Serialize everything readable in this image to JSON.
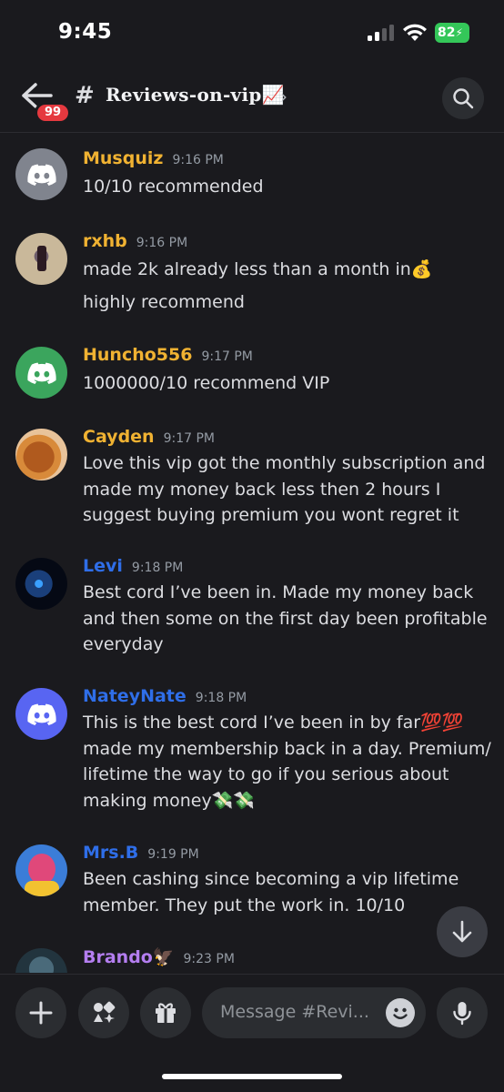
{
  "status_bar": {
    "time": "9:45",
    "battery": "82"
  },
  "header": {
    "back_badge": "99",
    "hash": "#",
    "channel_name": "Reviews-on-vip📈",
    "chevron": "›"
  },
  "messages": [
    {
      "username": "Musquiz",
      "time": "9:16 PM",
      "color": "#f0b232",
      "avatar": "discord-grey",
      "lines": [
        "10/10 recommended"
      ]
    },
    {
      "username": "rxhb",
      "time": "9:16 PM",
      "color": "#f0b232",
      "avatar": "photo",
      "lines": [
        "made 2k already less than a month in💰",
        "highly recommend"
      ]
    },
    {
      "username": "Huncho556",
      "time": "9:17 PM",
      "color": "#f0b232",
      "avatar": "discord-green",
      "lines": [
        "1000000/10 recommend VIP"
      ]
    },
    {
      "username": "Cayden",
      "time": "9:17 PM",
      "color": "#f0b232",
      "avatar": "photo",
      "lines": [
        "Love this vip got the monthly subscription and made my money back less then 2 hours I suggest buying premium you wont regret it"
      ]
    },
    {
      "username": "Levi",
      "time": "9:18 PM",
      "color": "#2f6ee8",
      "avatar": "photo",
      "lines": [
        "Best cord I’ve been in. Made my money back and then some on the first day been profitable everyday"
      ]
    },
    {
      "username": "NateyNate",
      "time": "9:18 PM",
      "color": "#2f6ee8",
      "avatar": "discord-blue",
      "lines": [
        "This is the best cord I’ve been in by far💯💯 made my membership back in a day. Premium/ lifetime the way to go if you serious about making money💸💸"
      ]
    },
    {
      "username": "Mrs.B",
      "time": "9:19 PM",
      "color": "#2f6ee8",
      "avatar": "photo",
      "lines": [
        "Been cashing since becoming a vip lifetime member. They put the work in. 10/10"
      ]
    },
    {
      "username": "Brando🦅",
      "time": "9:23 PM",
      "color": "#b47ef0",
      "avatar": "photo",
      "lines": []
    }
  ],
  "composer": {
    "placeholder": "Message #Revi..."
  }
}
